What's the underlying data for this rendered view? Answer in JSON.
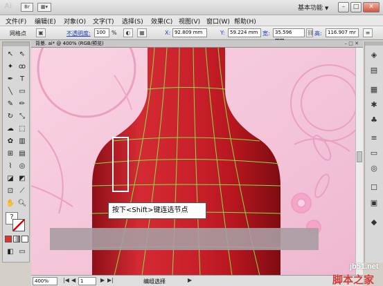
{
  "app": {
    "logo": "Ai",
    "bridge_label": "Br",
    "workspace": "基本功能",
    "arrange_icon": "arrange-icon"
  },
  "menu": [
    "文件(F)",
    "编辑(E)",
    "对象(O)",
    "文字(T)",
    "选择(S)",
    "效果(C)",
    "视图(V)",
    "窗口(W)",
    "帮助(H)"
  ],
  "control": {
    "selection_type": "网格点",
    "opacity_label": "不透明度:",
    "opacity_value": "100",
    "opacity_unit": "%",
    "x_label": "X:",
    "x_value": "92.809 mm",
    "y_label": "Y:",
    "y_value": "59.224 mm",
    "w_label": "宽:",
    "w_value": "35.596 mm",
    "h_label": "高:",
    "h_value": "116.907 mr"
  },
  "document": {
    "tab_title": "背景. ai* @ 400% (RGB/预览)"
  },
  "callout": "按下<Shift>键连选节点",
  "status": {
    "zoom": "400%",
    "page": "1",
    "tool_text": "编组选择"
  },
  "watermark": {
    "site": "jb51.net",
    "brand": "脚本之家"
  },
  "colors": {
    "bottle_red": "#c8202a",
    "background_pink": "#f3c3d8",
    "mesh_line": "#7fe34a",
    "selection_box": "#ffffff"
  }
}
